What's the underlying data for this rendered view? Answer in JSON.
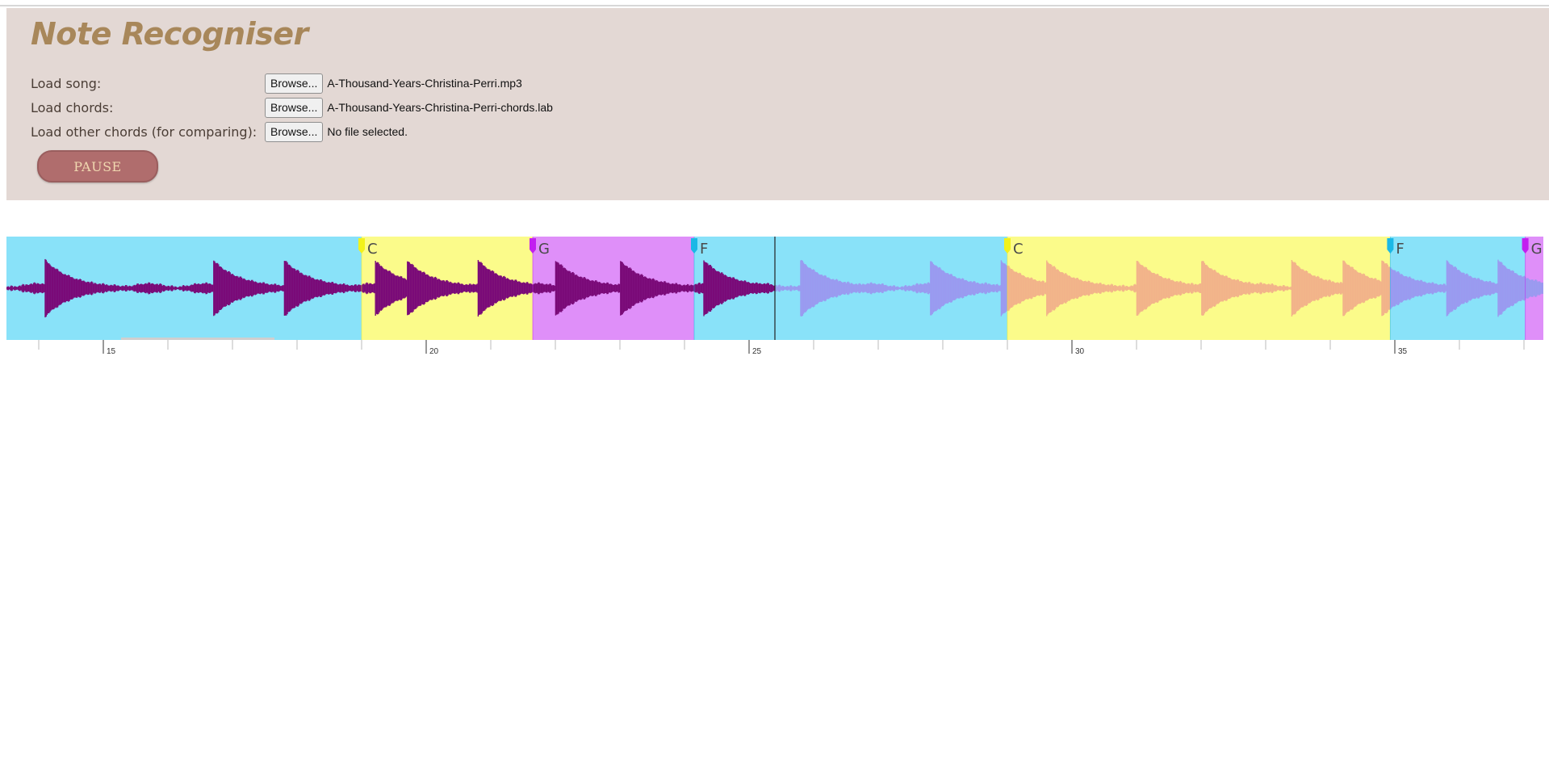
{
  "app": {
    "title": "Note Recogniser"
  },
  "loaders": [
    {
      "label": "Load song:",
      "button": "Browse...",
      "file": "A-Thousand-Years-Christina-Perri.mp3"
    },
    {
      "label": "Load chords:",
      "button": "Browse...",
      "file": "A-Thousand-Years-Christina-Perri-chords.lab"
    },
    {
      "label": "Load other chords (for comparing):",
      "button": "Browse...",
      "file": "No file selected."
    }
  ],
  "controls": {
    "pause_label": "PAUSE"
  },
  "colors": {
    "chord_C": "#fbfb8a",
    "chord_G": "#df8ff9",
    "chord_F": "#89e2f9",
    "marker_C": "#f2f21a",
    "marker_G": "#c21ff0",
    "marker_F": "#1ab8e6",
    "wave_played": "#7a0a78",
    "wave_unplayed": "#9a9af0",
    "wave_unplayed_on_yellow": "#f2b38a"
  },
  "waveform": {
    "view_start_s": 13.5,
    "view_end_s": 37.3,
    "playhead_s": 25.4,
    "regions": [
      {
        "chord": "F",
        "start": 13.5,
        "end": 19.0,
        "show_label": false
      },
      {
        "chord": "C",
        "start": 19.0,
        "end": 21.65,
        "show_label": true
      },
      {
        "chord": "G",
        "start": 21.65,
        "end": 24.15,
        "show_label": true
      },
      {
        "chord": "F",
        "start": 24.15,
        "end": 29.0,
        "show_label": true
      },
      {
        "chord": "C",
        "start": 29.0,
        "end": 34.93,
        "show_label": true
      },
      {
        "chord": "F",
        "start": 34.93,
        "end": 37.02,
        "show_label": true
      },
      {
        "chord": "G",
        "start": 37.02,
        "end": 37.3,
        "show_label": true
      }
    ],
    "onsets": [
      14.1,
      16.7,
      17.8,
      19.2,
      19.7,
      20.8,
      22.0,
      23.0,
      24.3,
      25.8,
      27.8,
      28.9,
      29.6,
      31.0,
      32.0,
      33.4,
      34.2,
      34.8,
      35.8,
      36.6
    ],
    "tick_labels": [
      "15",
      "20",
      "25",
      "30",
      "35"
    ],
    "tick_values": [
      15,
      20,
      25,
      30,
      35
    ]
  }
}
